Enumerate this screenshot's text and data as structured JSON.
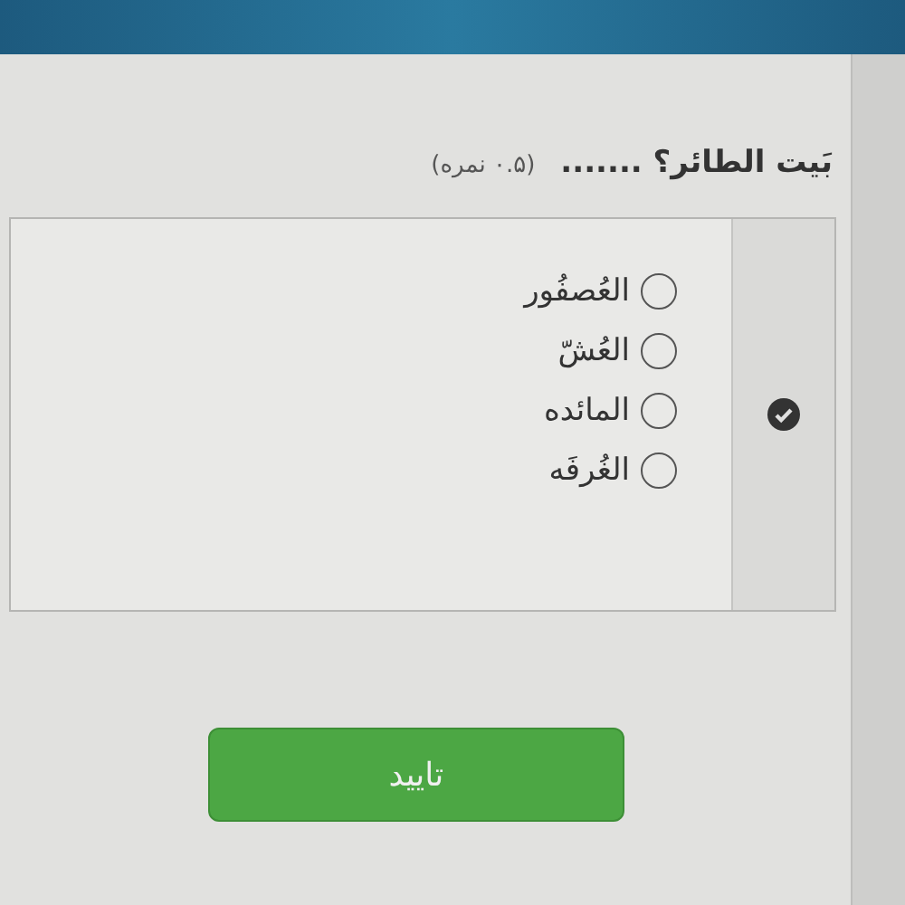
{
  "question": {
    "text": "بَيت الطائر؟ .......",
    "points": "(۰.۵ نمره)"
  },
  "options": [
    {
      "label": "العُصفُور",
      "selected": false
    },
    {
      "label": "العُشّ",
      "selected": false
    },
    {
      "label": "المائده",
      "selected": false
    },
    {
      "label": "الغُرفَه",
      "selected": false
    }
  ],
  "submit": "تایید"
}
